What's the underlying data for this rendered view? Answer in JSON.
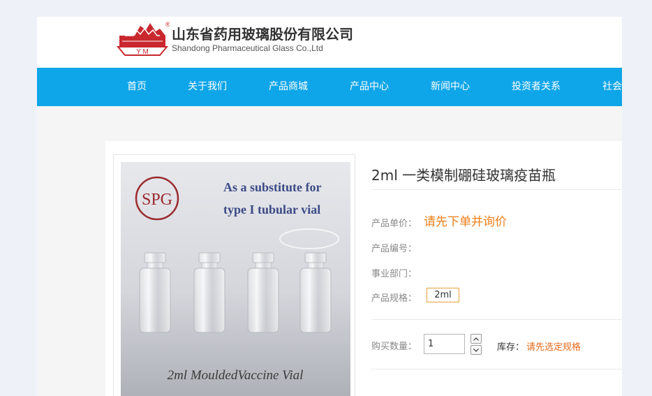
{
  "header": {
    "company_name_cn": "山东省药用玻璃股份有限公司",
    "company_name_en": "Shandong Pharmaceutical Glass Co.,Ltd",
    "logo_letters": "Y M",
    "logo_mark": "®"
  },
  "nav": {
    "items": [
      {
        "label": "首页"
      },
      {
        "label": "关于我们"
      },
      {
        "label": "产品商城"
      },
      {
        "label": "产品中心"
      },
      {
        "label": "新闻中心"
      },
      {
        "label": "投资者关系"
      },
      {
        "label": "社会"
      }
    ]
  },
  "product": {
    "image": {
      "logo_text": "SPG",
      "headline_line1": "As a substitute for",
      "headline_line2": "type I tubular vial",
      "caption": "2ml MouldedVaccine Vial"
    },
    "title": "2ml 一类模制硼硅玻璃疫苗瓶",
    "price_label": "产品单价：",
    "price_value": "请先下单并询价",
    "code_label": "产品编号：",
    "dept_label": "事业部门：",
    "spec_label": "产品规格：",
    "spec_option": "2ml",
    "qty_label": "购买数量：",
    "qty_value": "1",
    "stock_label": "库存：",
    "stock_value": "请先选定规格"
  },
  "colors": {
    "page_bg": "#eef1f8",
    "nav_bg": "#0fa6e9",
    "accent_orange": "#f07f1a",
    "spec_border": "#e4a23a"
  }
}
